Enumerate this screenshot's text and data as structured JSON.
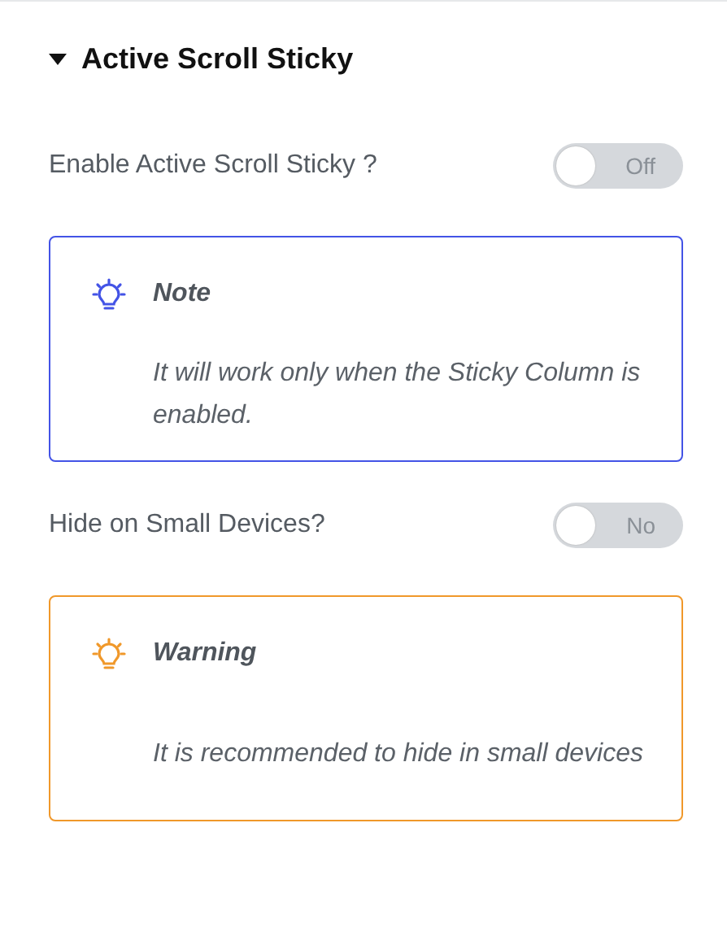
{
  "section": {
    "title": "Active Scroll Sticky",
    "expanded": true
  },
  "controls": [
    {
      "kind": "toggle",
      "label": "Enable Active Scroll Sticky ?",
      "on": false,
      "state_text": "Off"
    },
    {
      "kind": "notice",
      "color": "#4353e6",
      "title": "Note",
      "text": "It will work only when the Sticky Column is enabled."
    },
    {
      "kind": "toggle",
      "label": "Hide on Small Devices?",
      "on": false,
      "state_text": "No"
    },
    {
      "kind": "notice",
      "color": "#f0982a",
      "title": "Warning",
      "text": "It is recommended to hide in small devices"
    }
  ]
}
